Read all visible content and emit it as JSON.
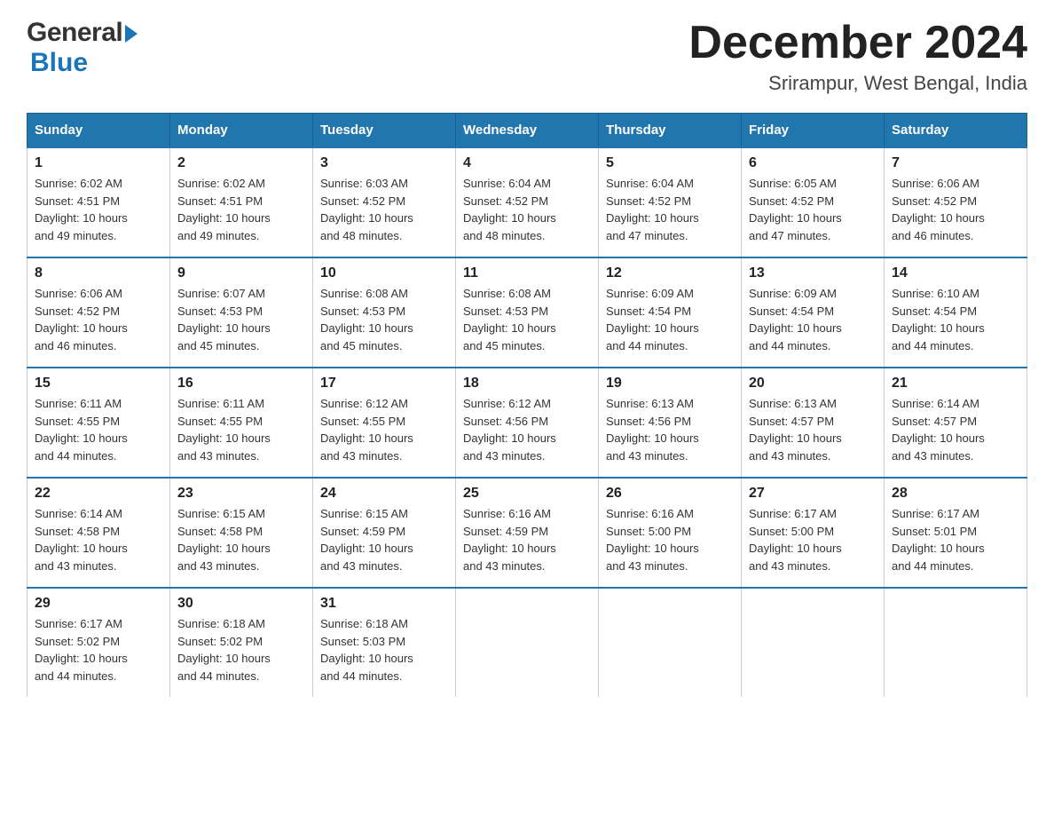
{
  "header": {
    "logo_general": "General",
    "logo_blue": "Blue",
    "month_title": "December 2024",
    "location": "Srirampur, West Bengal, India"
  },
  "days_of_week": [
    "Sunday",
    "Monday",
    "Tuesday",
    "Wednesday",
    "Thursday",
    "Friday",
    "Saturday"
  ],
  "weeks": [
    [
      {
        "day": "1",
        "sunrise": "6:02 AM",
        "sunset": "4:51 PM",
        "daylight": "10 hours and 49 minutes."
      },
      {
        "day": "2",
        "sunrise": "6:02 AM",
        "sunset": "4:51 PM",
        "daylight": "10 hours and 49 minutes."
      },
      {
        "day": "3",
        "sunrise": "6:03 AM",
        "sunset": "4:52 PM",
        "daylight": "10 hours and 48 minutes."
      },
      {
        "day": "4",
        "sunrise": "6:04 AM",
        "sunset": "4:52 PM",
        "daylight": "10 hours and 48 minutes."
      },
      {
        "day": "5",
        "sunrise": "6:04 AM",
        "sunset": "4:52 PM",
        "daylight": "10 hours and 47 minutes."
      },
      {
        "day": "6",
        "sunrise": "6:05 AM",
        "sunset": "4:52 PM",
        "daylight": "10 hours and 47 minutes."
      },
      {
        "day": "7",
        "sunrise": "6:06 AM",
        "sunset": "4:52 PM",
        "daylight": "10 hours and 46 minutes."
      }
    ],
    [
      {
        "day": "8",
        "sunrise": "6:06 AM",
        "sunset": "4:52 PM",
        "daylight": "10 hours and 46 minutes."
      },
      {
        "day": "9",
        "sunrise": "6:07 AM",
        "sunset": "4:53 PM",
        "daylight": "10 hours and 45 minutes."
      },
      {
        "day": "10",
        "sunrise": "6:08 AM",
        "sunset": "4:53 PM",
        "daylight": "10 hours and 45 minutes."
      },
      {
        "day": "11",
        "sunrise": "6:08 AM",
        "sunset": "4:53 PM",
        "daylight": "10 hours and 45 minutes."
      },
      {
        "day": "12",
        "sunrise": "6:09 AM",
        "sunset": "4:54 PM",
        "daylight": "10 hours and 44 minutes."
      },
      {
        "day": "13",
        "sunrise": "6:09 AM",
        "sunset": "4:54 PM",
        "daylight": "10 hours and 44 minutes."
      },
      {
        "day": "14",
        "sunrise": "6:10 AM",
        "sunset": "4:54 PM",
        "daylight": "10 hours and 44 minutes."
      }
    ],
    [
      {
        "day": "15",
        "sunrise": "6:11 AM",
        "sunset": "4:55 PM",
        "daylight": "10 hours and 44 minutes."
      },
      {
        "day": "16",
        "sunrise": "6:11 AM",
        "sunset": "4:55 PM",
        "daylight": "10 hours and 43 minutes."
      },
      {
        "day": "17",
        "sunrise": "6:12 AM",
        "sunset": "4:55 PM",
        "daylight": "10 hours and 43 minutes."
      },
      {
        "day": "18",
        "sunrise": "6:12 AM",
        "sunset": "4:56 PM",
        "daylight": "10 hours and 43 minutes."
      },
      {
        "day": "19",
        "sunrise": "6:13 AM",
        "sunset": "4:56 PM",
        "daylight": "10 hours and 43 minutes."
      },
      {
        "day": "20",
        "sunrise": "6:13 AM",
        "sunset": "4:57 PM",
        "daylight": "10 hours and 43 minutes."
      },
      {
        "day": "21",
        "sunrise": "6:14 AM",
        "sunset": "4:57 PM",
        "daylight": "10 hours and 43 minutes."
      }
    ],
    [
      {
        "day": "22",
        "sunrise": "6:14 AM",
        "sunset": "4:58 PM",
        "daylight": "10 hours and 43 minutes."
      },
      {
        "day": "23",
        "sunrise": "6:15 AM",
        "sunset": "4:58 PM",
        "daylight": "10 hours and 43 minutes."
      },
      {
        "day": "24",
        "sunrise": "6:15 AM",
        "sunset": "4:59 PM",
        "daylight": "10 hours and 43 minutes."
      },
      {
        "day": "25",
        "sunrise": "6:16 AM",
        "sunset": "4:59 PM",
        "daylight": "10 hours and 43 minutes."
      },
      {
        "day": "26",
        "sunrise": "6:16 AM",
        "sunset": "5:00 PM",
        "daylight": "10 hours and 43 minutes."
      },
      {
        "day": "27",
        "sunrise": "6:17 AM",
        "sunset": "5:00 PM",
        "daylight": "10 hours and 43 minutes."
      },
      {
        "day": "28",
        "sunrise": "6:17 AM",
        "sunset": "5:01 PM",
        "daylight": "10 hours and 44 minutes."
      }
    ],
    [
      {
        "day": "29",
        "sunrise": "6:17 AM",
        "sunset": "5:02 PM",
        "daylight": "10 hours and 44 minutes."
      },
      {
        "day": "30",
        "sunrise": "6:18 AM",
        "sunset": "5:02 PM",
        "daylight": "10 hours and 44 minutes."
      },
      {
        "day": "31",
        "sunrise": "6:18 AM",
        "sunset": "5:03 PM",
        "daylight": "10 hours and 44 minutes."
      },
      null,
      null,
      null,
      null
    ]
  ],
  "labels": {
    "sunrise": "Sunrise:",
    "sunset": "Sunset:",
    "daylight": "Daylight:"
  }
}
